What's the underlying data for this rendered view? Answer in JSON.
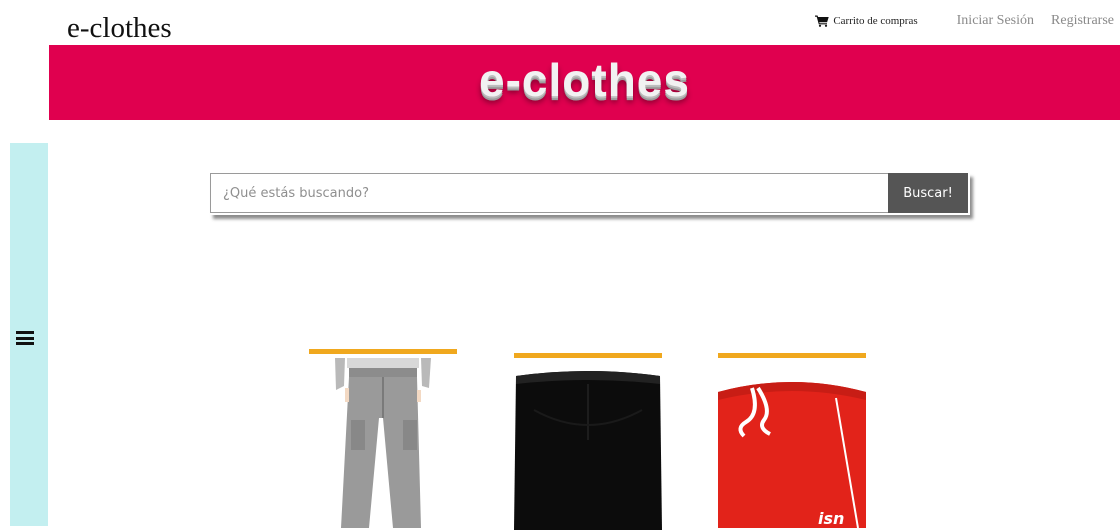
{
  "header": {
    "brand": "e-clothes",
    "cart_label": "Carrito de compras",
    "login_label": "Iniciar Sesión",
    "register_label": "Registrarse"
  },
  "banner": {
    "title": "e-clothes"
  },
  "search": {
    "placeholder": "¿Qué estás buscando?",
    "button_label": "Buscar!"
  },
  "products": [
    {
      "image": "grey-cargo-pants"
    },
    {
      "image": "black-shorts"
    },
    {
      "image": "red-sport-shorts"
    }
  ],
  "colors": {
    "banner": "#e0004f",
    "sidebar": "#c3eff0",
    "accent_bar": "#f0a81e",
    "search_button": "#555555"
  },
  "icons": [
    "cart-icon",
    "menu-icon"
  ]
}
